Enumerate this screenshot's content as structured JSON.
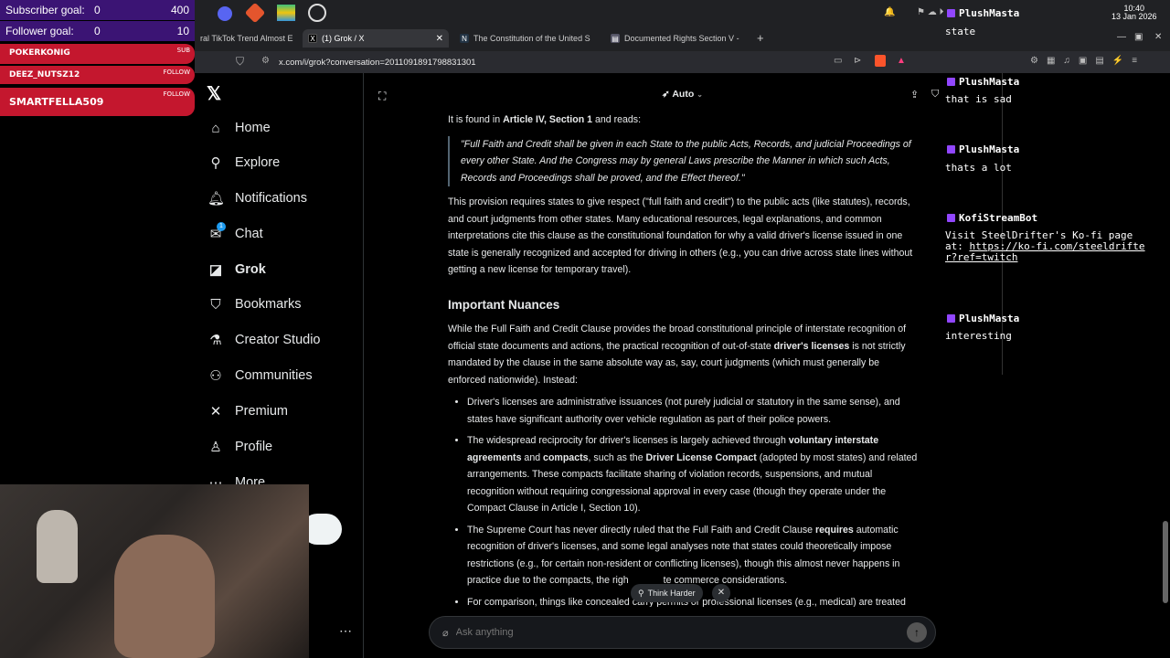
{
  "overlay": {
    "subscriber_label": "Subscriber goal:",
    "subscriber_current": "0",
    "subscriber_target": "400",
    "follower_label": "Follower goal:",
    "follower_current": "0",
    "follower_target": "10",
    "alerts": [
      {
        "name": "POKERKONIG",
        "tag": "SUB"
      },
      {
        "name": "DEEZ_NUTSZ12",
        "tag": "FOLLOW"
      },
      {
        "name": "SMARTFELLA509",
        "tag": "FOLLOW"
      }
    ]
  },
  "browser": {
    "tabs": [
      {
        "title": "ral TikTok Trend Almost E"
      },
      {
        "title": "(1) Grok / X"
      },
      {
        "title": "The Constitution of the United S"
      },
      {
        "title": "Documented Rights Section V -"
      }
    ],
    "url": "x.com/i/grok?conversation=2011091891798831301",
    "clock_time": "10:40",
    "clock_date": "13 Jan 2026"
  },
  "sidebar": {
    "items": [
      {
        "label": "Home"
      },
      {
        "label": "Explore"
      },
      {
        "label": "Notifications"
      },
      {
        "label": "Chat",
        "badge": "1"
      },
      {
        "label": "Grok"
      },
      {
        "label": "Bookmarks"
      },
      {
        "label": "Creator Studio"
      },
      {
        "label": "Communities"
      },
      {
        "label": "Premium"
      },
      {
        "label": "Profile"
      },
      {
        "label": "More"
      }
    ]
  },
  "header": {
    "mode_label": "Auto"
  },
  "article": {
    "intro_pre": "It is found in ",
    "intro_bold": "Article IV, Section 1",
    "intro_post": " and reads:",
    "quote": "\"Full Faith and Credit shall be given in each State to the public Acts, Records, and judicial Proceedings of every other State. And the Congress may by general Laws prescribe the Manner in which such Acts, Records and Proceedings shall be proved, and the Effect thereof.\"",
    "para1": "This provision requires states to give respect (\"full faith and credit\") to the public acts (like statutes), records, and court judgments from other states. Many educational resources, legal explanations, and common interpretations cite this clause as the constitutional foundation for why a valid driver's license issued in one state is generally recognized and accepted for driving in others (e.g., you can drive across state lines without getting a new license for temporary travel).",
    "heading": "Important Nuances",
    "para2_a": "While the Full Faith and Credit Clause provides the broad constitutional principle of interstate recognition of official state documents and actions, the practical recognition of out-of-state ",
    "para2_bold": "driver's licenses",
    "para2_b": " is not strictly mandated by the clause in the same absolute way as, say, court judgments (which must generally be enforced nationwide). Instead:",
    "b1": "Driver's licenses are administrative issuances (not purely judicial or statutory in the same sense), and states have significant authority over vehicle regulation as part of their police powers.",
    "b2_a": "The widespread reciprocity for driver's licenses is largely achieved through ",
    "b2_bold1": "voluntary interstate agreements",
    "b2_b": " and ",
    "b2_bold2": "compacts",
    "b2_c": ", such as the ",
    "b2_bold3": "Driver License Compact",
    "b2_d": " (adopted by most states) and related arrangements. These compacts facilitate sharing of violation records, suspensions, and mutual recognition without requiring congressional approval in every case (though they operate under the Compact Clause in Article I, Section 10).",
    "b3_a": "The Supreme Court has never directly ruled that the Full Faith and Credit Clause ",
    "b3_bold": "requires",
    "b3_b": " automatic recognition of driver's licenses, and some legal analyses note that states could theoretically impose restrictions (e.g., for certain non-resident or conflicting licenses), though this almost never happens in practice due to the compacts, the righ",
    "b3_c": "te commerce considerations.",
    "b4": "For comparison, things like concealed carry permits or professional licenses (e.g., medical) are treated"
  },
  "composer": {
    "think_harder": "Think Harder",
    "placeholder": "Ask anything"
  },
  "chat": {
    "messages": [
      {
        "user": "PlushMasta",
        "text": "state"
      },
      {
        "user": "PlushMasta",
        "text": "that is sad"
      },
      {
        "user": "PlushMasta",
        "text": "thats a lot"
      },
      {
        "user": "KofiStreamBot",
        "text": "Visit SteelDrifter's Ko-fi page at: ",
        "link": "https://ko-fi.com/steeldrifter?ref=twitch"
      },
      {
        "user": "PlushMasta",
        "text": "interesting"
      }
    ]
  },
  "colors": {
    "overlay_purple": "#3b1474",
    "alert_red": "#c4172e",
    "twitch_purple": "#9146ff",
    "x_text": "#e7e9ea"
  }
}
